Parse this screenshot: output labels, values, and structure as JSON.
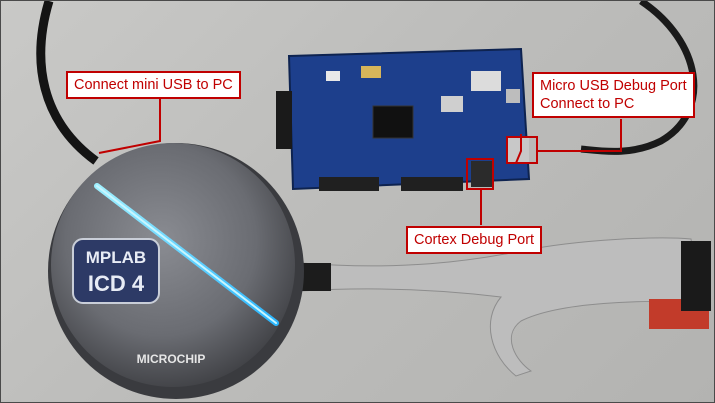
{
  "photo": {
    "kind": "photograph of MPLAB ICD 4 debugger connected to a development board",
    "device_logo_line1": "MPLAB",
    "device_logo_line2": "ICD 4",
    "device_brand": "MICROCHIP"
  },
  "callouts": {
    "mini_usb": "Connect mini USB to PC",
    "micro_usb_line1": "Micro USB Debug Port",
    "micro_usb_line2": "Connect to PC",
    "cortex": "Cortex Debug Port"
  },
  "colors": {
    "callout_border": "#c00000",
    "callout_text": "#c00000",
    "board": "#1d3f8c",
    "debugger_face": "#6e7076",
    "led_glow": "#6fd8ff",
    "ribbon_cable": "#bdbdbd"
  }
}
